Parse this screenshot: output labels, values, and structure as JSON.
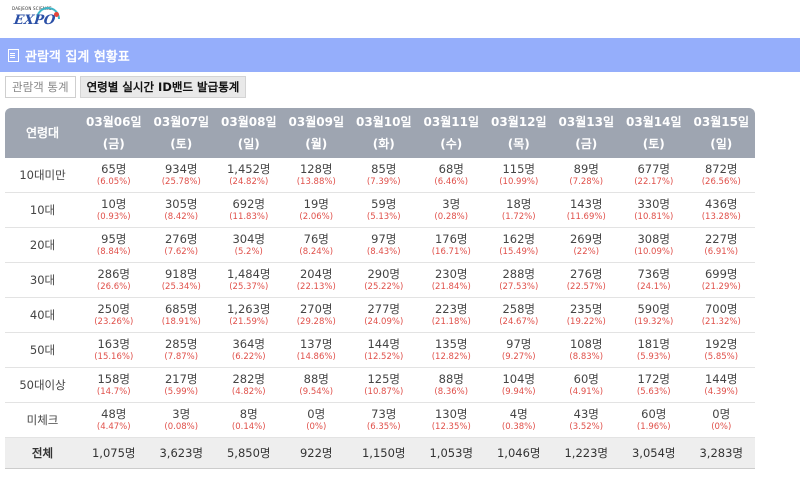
{
  "logo": {
    "small_text": "DAEJEON SCIENCE",
    "main_text": "EXPO"
  },
  "header": {
    "title": "관람객 집계 현황표"
  },
  "tabs": [
    {
      "label": "관람객 통계",
      "active": false
    },
    {
      "label": "연령별 실시간 ID밴드 발급통계",
      "active": true
    }
  ],
  "table": {
    "corner": "연령대",
    "columns": [
      {
        "date": "03월06일",
        "weekday": "(금)"
      },
      {
        "date": "03월07일",
        "weekday": "(토)"
      },
      {
        "date": "03월08일",
        "weekday": "(일)"
      },
      {
        "date": "03월09일",
        "weekday": "(월)"
      },
      {
        "date": "03월10일",
        "weekday": "(화)"
      },
      {
        "date": "03월11일",
        "weekday": "(수)"
      },
      {
        "date": "03월12일",
        "weekday": "(목)"
      },
      {
        "date": "03월13일",
        "weekday": "(금)"
      },
      {
        "date": "03월14일",
        "weekday": "(토)"
      },
      {
        "date": "03월15일",
        "weekday": "(일)"
      }
    ],
    "rows": [
      {
        "label": "10대미만",
        "cells": [
          {
            "count": "65명",
            "pct": "(6.05%)"
          },
          {
            "count": "934명",
            "pct": "(25.78%)"
          },
          {
            "count": "1,452명",
            "pct": "(24.82%)"
          },
          {
            "count": "128명",
            "pct": "(13.88%)"
          },
          {
            "count": "85명",
            "pct": "(7.39%)"
          },
          {
            "count": "68명",
            "pct": "(6.46%)"
          },
          {
            "count": "115명",
            "pct": "(10.99%)"
          },
          {
            "count": "89명",
            "pct": "(7.28%)"
          },
          {
            "count": "677명",
            "pct": "(22.17%)"
          },
          {
            "count": "872명",
            "pct": "(26.56%)"
          }
        ]
      },
      {
        "label": "10대",
        "cells": [
          {
            "count": "10명",
            "pct": "(0.93%)"
          },
          {
            "count": "305명",
            "pct": "(8.42%)"
          },
          {
            "count": "692명",
            "pct": "(11.83%)"
          },
          {
            "count": "19명",
            "pct": "(2.06%)"
          },
          {
            "count": "59명",
            "pct": "(5.13%)"
          },
          {
            "count": "3명",
            "pct": "(0.28%)"
          },
          {
            "count": "18명",
            "pct": "(1.72%)"
          },
          {
            "count": "143명",
            "pct": "(11.69%)"
          },
          {
            "count": "330명",
            "pct": "(10.81%)"
          },
          {
            "count": "436명",
            "pct": "(13.28%)"
          }
        ]
      },
      {
        "label": "20대",
        "cells": [
          {
            "count": "95명",
            "pct": "(8.84%)"
          },
          {
            "count": "276명",
            "pct": "(7.62%)"
          },
          {
            "count": "304명",
            "pct": "(5.2%)"
          },
          {
            "count": "76명",
            "pct": "(8.24%)"
          },
          {
            "count": "97명",
            "pct": "(8.43%)"
          },
          {
            "count": "176명",
            "pct": "(16.71%)"
          },
          {
            "count": "162명",
            "pct": "(15.49%)"
          },
          {
            "count": "269명",
            "pct": "(22%)"
          },
          {
            "count": "308명",
            "pct": "(10.09%)"
          },
          {
            "count": "227명",
            "pct": "(6.91%)"
          }
        ]
      },
      {
        "label": "30대",
        "cells": [
          {
            "count": "286명",
            "pct": "(26.6%)"
          },
          {
            "count": "918명",
            "pct": "(25.34%)"
          },
          {
            "count": "1,484명",
            "pct": "(25.37%)"
          },
          {
            "count": "204명",
            "pct": "(22.13%)"
          },
          {
            "count": "290명",
            "pct": "(25.22%)"
          },
          {
            "count": "230명",
            "pct": "(21.84%)"
          },
          {
            "count": "288명",
            "pct": "(27.53%)"
          },
          {
            "count": "276명",
            "pct": "(22.57%)"
          },
          {
            "count": "736명",
            "pct": "(24.1%)"
          },
          {
            "count": "699명",
            "pct": "(21.29%)"
          }
        ]
      },
      {
        "label": "40대",
        "cells": [
          {
            "count": "250명",
            "pct": "(23.26%)"
          },
          {
            "count": "685명",
            "pct": "(18.91%)"
          },
          {
            "count": "1,263명",
            "pct": "(21.59%)"
          },
          {
            "count": "270명",
            "pct": "(29.28%)"
          },
          {
            "count": "277명",
            "pct": "(24.09%)"
          },
          {
            "count": "223명",
            "pct": "(21.18%)"
          },
          {
            "count": "258명",
            "pct": "(24.67%)"
          },
          {
            "count": "235명",
            "pct": "(19.22%)"
          },
          {
            "count": "590명",
            "pct": "(19.32%)"
          },
          {
            "count": "700명",
            "pct": "(21.32%)"
          }
        ]
      },
      {
        "label": "50대",
        "cells": [
          {
            "count": "163명",
            "pct": "(15.16%)"
          },
          {
            "count": "285명",
            "pct": "(7.87%)"
          },
          {
            "count": "364명",
            "pct": "(6.22%)"
          },
          {
            "count": "137명",
            "pct": "(14.86%)"
          },
          {
            "count": "144명",
            "pct": "(12.52%)"
          },
          {
            "count": "135명",
            "pct": "(12.82%)"
          },
          {
            "count": "97명",
            "pct": "(9.27%)"
          },
          {
            "count": "108명",
            "pct": "(8.83%)"
          },
          {
            "count": "181명",
            "pct": "(5.93%)"
          },
          {
            "count": "192명",
            "pct": "(5.85%)"
          }
        ]
      },
      {
        "label": "50대이상",
        "cells": [
          {
            "count": "158명",
            "pct": "(14.7%)"
          },
          {
            "count": "217명",
            "pct": "(5.99%)"
          },
          {
            "count": "282명",
            "pct": "(4.82%)"
          },
          {
            "count": "88명",
            "pct": "(9.54%)"
          },
          {
            "count": "125명",
            "pct": "(10.87%)"
          },
          {
            "count": "88명",
            "pct": "(8.36%)"
          },
          {
            "count": "104명",
            "pct": "(9.94%)"
          },
          {
            "count": "60명",
            "pct": "(4.91%)"
          },
          {
            "count": "172명",
            "pct": "(5.63%)"
          },
          {
            "count": "144명",
            "pct": "(4.39%)"
          }
        ]
      },
      {
        "label": "미체크",
        "cells": [
          {
            "count": "48명",
            "pct": "(4.47%)"
          },
          {
            "count": "3명",
            "pct": "(0.08%)"
          },
          {
            "count": "8명",
            "pct": "(0.14%)"
          },
          {
            "count": "0명",
            "pct": "(0%)"
          },
          {
            "count": "73명",
            "pct": "(6.35%)"
          },
          {
            "count": "130명",
            "pct": "(12.35%)"
          },
          {
            "count": "4명",
            "pct": "(0.38%)"
          },
          {
            "count": "43명",
            "pct": "(3.52%)"
          },
          {
            "count": "60명",
            "pct": "(1.96%)"
          },
          {
            "count": "0명",
            "pct": "(0%)"
          }
        ]
      }
    ],
    "total": {
      "label": "전체",
      "cells": [
        "1,075명",
        "3,623명",
        "5,850명",
        "922명",
        "1,150명",
        "1,053명",
        "1,046명",
        "1,223명",
        "3,054명",
        "3,283명"
      ]
    }
  },
  "colors": {
    "title_bar": "#95aefb",
    "header_bg": "#9ea5b1",
    "percent_red": "#e0504a"
  }
}
